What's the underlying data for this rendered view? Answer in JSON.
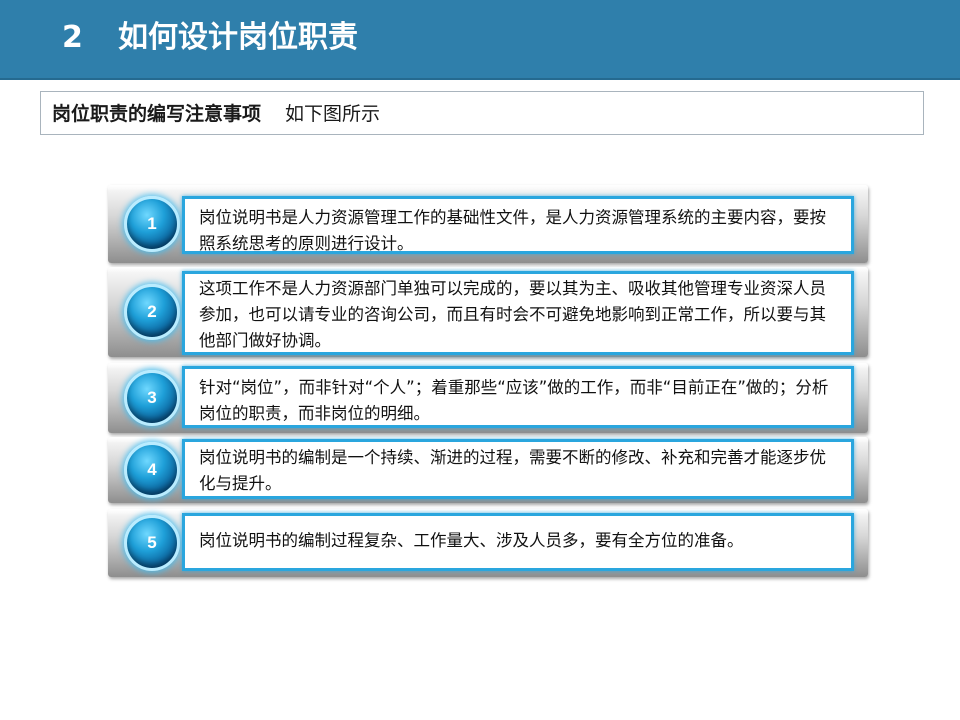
{
  "header": {
    "number": "2",
    "title": "如何设计岗位职责"
  },
  "subtitle": {
    "bold": "岗位职责的编写注意事项",
    "normal": "如下图所示"
  },
  "items": [
    {
      "number": "1",
      "text": "岗位说明书是人力资源管理工作的基础性文件，是人力资源管理系统的主要内容，要按照系统思考的原则进行设计。"
    },
    {
      "number": "2",
      "text": "这项工作不是人力资源部门单独可以完成的，要以其为主、吸收其他管理专业资深人员参加，也可以请专业的咨询公司，而且有时会不可避免地影响到正常工作，所以要与其他部门做好协调。"
    },
    {
      "number": "3",
      "text": "针对“岗位”，而非针对“个人”；着重那些“应该”做的工作，而非“目前正在”做的；分析岗位的职责，而非岗位的明细。"
    },
    {
      "number": "4",
      "text": "岗位说明书的编制是一个持续、渐进的过程，需要不断的修改、补充和完善才能逐步优化与提升。"
    },
    {
      "number": "5",
      "text": "岗位说明书的编制过程复杂、工作量大、涉及人员多，要有全方位的准备。"
    }
  ],
  "colors": {
    "header_bar": "#2f7fab",
    "accent_border": "#2aa6de",
    "badge": "#1e9fd8"
  }
}
